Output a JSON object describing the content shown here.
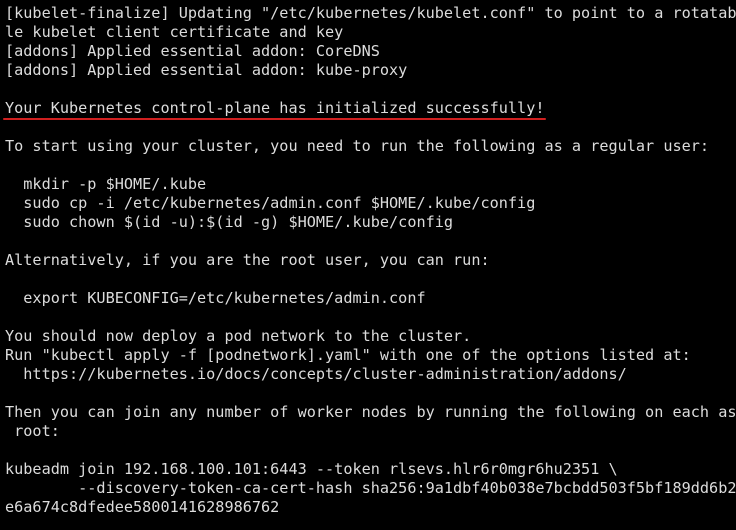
{
  "terminal": {
    "accent_color": "#d02020",
    "lines": [
      "[kubelet-finalize] Updating \"/etc/kubernetes/kubelet.conf\" to point to a rotatab",
      "le kubelet client certificate and key",
      "[addons] Applied essential addon: CoreDNS",
      "[addons] Applied essential addon: kube-proxy",
      "",
      "Your Kubernetes control-plane has initialized successfully!",
      "",
      "To start using your cluster, you need to run the following as a regular user:",
      "",
      "  mkdir -p $HOME/.kube",
      "  sudo cp -i /etc/kubernetes/admin.conf $HOME/.kube/config",
      "  sudo chown $(id -u):$(id -g) $HOME/.kube/config",
      "",
      "Alternatively, if you are the root user, you can run:",
      "",
      "  export KUBECONFIG=/etc/kubernetes/admin.conf",
      "",
      "You should now deploy a pod network to the cluster.",
      "Run \"kubectl apply -f [podnetwork].yaml\" with one of the options listed at:",
      "  https://kubernetes.io/docs/concepts/cluster-administration/addons/",
      "",
      "Then you can join any number of worker nodes by running the following on each as",
      " root:",
      "",
      "kubeadm join 192.168.100.101:6443 --token rlsevs.hlr6r0mgr6hu2351 \\",
      "        --discovery-token-ca-cert-hash sha256:9a1dbf40b038e7bcbdd503f5bf189dd6b2",
      "e6a674c8dfedee5800141628986762"
    ]
  }
}
